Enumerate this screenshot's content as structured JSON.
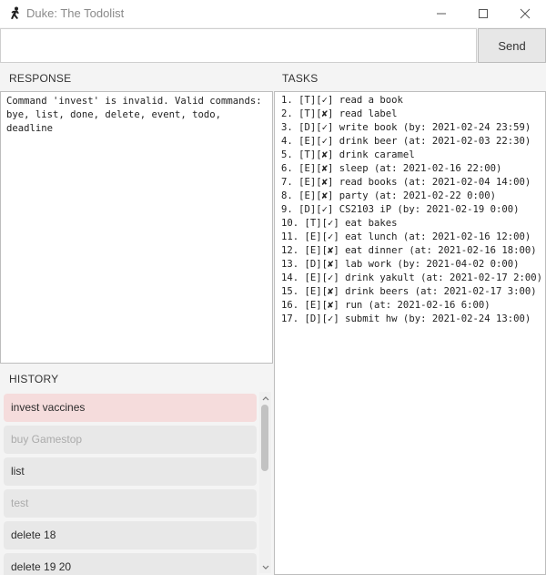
{
  "window": {
    "title": "Duke: The Todolist",
    "minimize_icon": "minimize-icon",
    "maximize_icon": "maximize-icon",
    "close_icon": "close-icon"
  },
  "input": {
    "value": "",
    "placeholder": ""
  },
  "send_label": "Send",
  "response": {
    "header": "RESPONSE",
    "text": "Command 'invest' is invalid. Valid commands: bye, list, done, delete, event, todo, deadline"
  },
  "tasks": {
    "header": "TASKS",
    "items": [
      "1. [T][✓] read a book",
      "2. [T][✘] read label",
      "3. [D][✓] write book (by: 2021-02-24 23:59)",
      "4. [E][✓] drink beer (at: 2021-02-03 22:30)",
      "5. [T][✘] drink caramel",
      "6. [E][✘] sleep (at: 2021-02-16 22:00)",
      "7. [E][✘] read books (at: 2021-02-04 14:00)",
      "8. [E][✘] party (at: 2021-02-22 0:00)",
      "9. [D][✓] CS2103 iP (by: 2021-02-19 0:00)",
      "10. [T][✓] eat bakes",
      "11. [E][✓] eat lunch (at: 2021-02-16 12:00)",
      "12. [E][✘] eat dinner (at: 2021-02-16 18:00)",
      "13. [D][✘] lab work (by: 2021-04-02 0:00)",
      "14. [E][✓] drink yakult (at: 2021-02-17 2:00)",
      "15. [E][✘] drink beers (at: 2021-02-17 3:00)",
      "16. [E][✘] run (at: 2021-02-16 6:00)",
      "17. [D][✓] submit hw (by: 2021-02-24 13:00)"
    ]
  },
  "history": {
    "header": "HISTORY",
    "items": [
      {
        "label": "invest vaccines",
        "state": "selected"
      },
      {
        "label": "buy Gamestop",
        "state": "faded"
      },
      {
        "label": "list",
        "state": "normal"
      },
      {
        "label": "test",
        "state": "faded"
      },
      {
        "label": "delete 18",
        "state": "normal"
      },
      {
        "label": "delete 19 20",
        "state": "normal"
      }
    ]
  },
  "colors": {
    "selected_history": "#f5dcdc",
    "history_item": "#e8e8e8",
    "faded_text": "#ababab"
  }
}
